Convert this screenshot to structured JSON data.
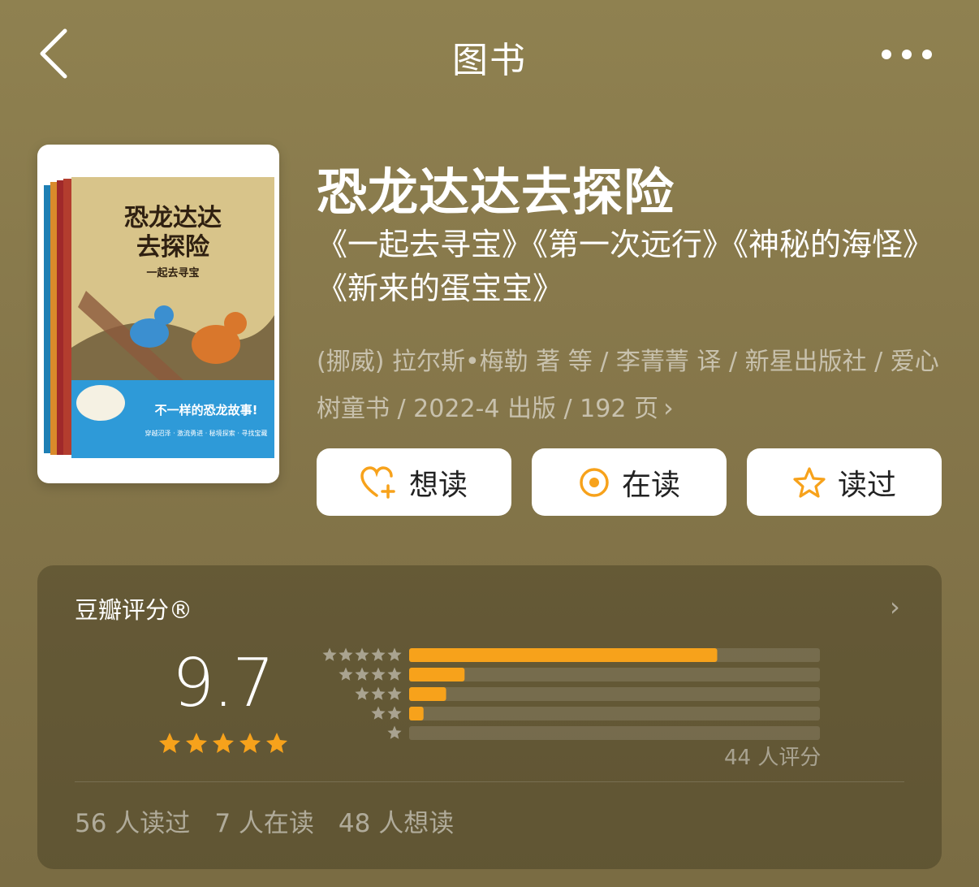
{
  "nav": {
    "title": "图书",
    "back_icon": "chevron-left-icon",
    "more_icon": "more-dots-icon"
  },
  "book": {
    "title": "恐龙达达去探险",
    "subtitle": "《一起去寻宝》《第一次远行》《神秘的海怪》《新来的蛋宝宝》",
    "meta": "(挪威) 拉尔斯•梅勒 著 等 / 李菁菁 译 / 新星出版社 / 爱心树童书 / 2022-4 出版 / 192 页",
    "cover": {
      "title_line1": "恐龙达达",
      "title_line2": "去探险",
      "subtitle": "一起去寻宝",
      "banner": "不一样的恐龙故事!",
      "tagline": "穿越沼泽 · 激流勇进 · 秘境探索 · 寻找宝藏"
    }
  },
  "actions": [
    {
      "label": "想读",
      "icon": "heart-plus-icon"
    },
    {
      "label": "在读",
      "icon": "reading-target-icon"
    },
    {
      "label": "读过",
      "icon": "star-outline-icon"
    }
  ],
  "rating": {
    "title": "豆瓣评分®",
    "score": "9.7",
    "stars": 5,
    "distribution": [
      0.75,
      0.135,
      0.09,
      0.035,
      0.0
    ],
    "count_text": "44 人评分",
    "stats": [
      "56 人读过",
      "7 人在读",
      "48 人想读"
    ]
  },
  "colors": {
    "accent": "#f7a21b",
    "background": "#8a7c4d"
  }
}
